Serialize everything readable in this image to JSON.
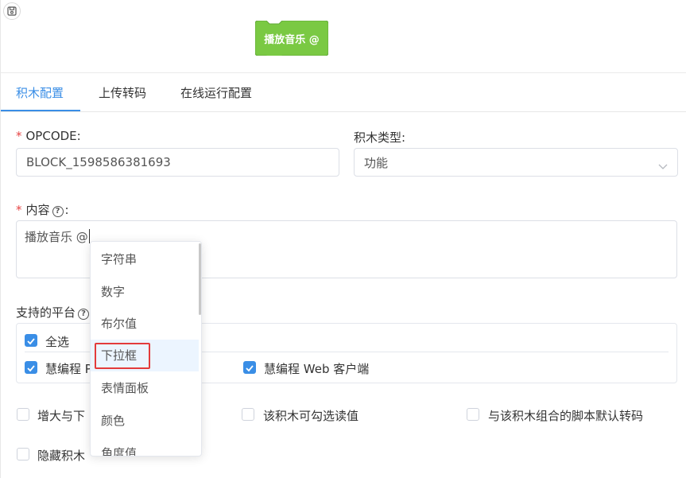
{
  "preview": {
    "block_label": "播放音乐 @",
    "block_color": "#7ac943",
    "save_icon": "save-icon"
  },
  "tabs": [
    {
      "label": "积木配置",
      "active": true
    },
    {
      "label": "上传转码",
      "active": false
    },
    {
      "label": "在线运行配置",
      "active": false
    }
  ],
  "form": {
    "opcode_label": "OPCODE:",
    "opcode_value": "BLOCK_1598586381693",
    "type_label": "积木类型:",
    "type_value": "功能",
    "content_label": "内容",
    "content_suffix": ":",
    "content_value": "播放音乐 @",
    "platform_label": "支持的平台",
    "select_all": "全选",
    "platform_1": "慧编程 P",
    "platform_2": "慧编程 Web 客户端",
    "option_1": "增大与下",
    "option_2": "该积木可勾选读值",
    "option_3": "与该积木组合的脚本默认转码",
    "option_4": "隐藏积木",
    "required_mark": "*"
  },
  "dropdown": {
    "items": [
      "字符串",
      "数字",
      "布尔值",
      "下拉框",
      "表情面板",
      "颜色",
      "角度值"
    ],
    "highlighted_index": 3
  },
  "colors": {
    "accent": "#3a8ee6",
    "required": "#e64545",
    "highlight_border": "#e33b3b"
  }
}
